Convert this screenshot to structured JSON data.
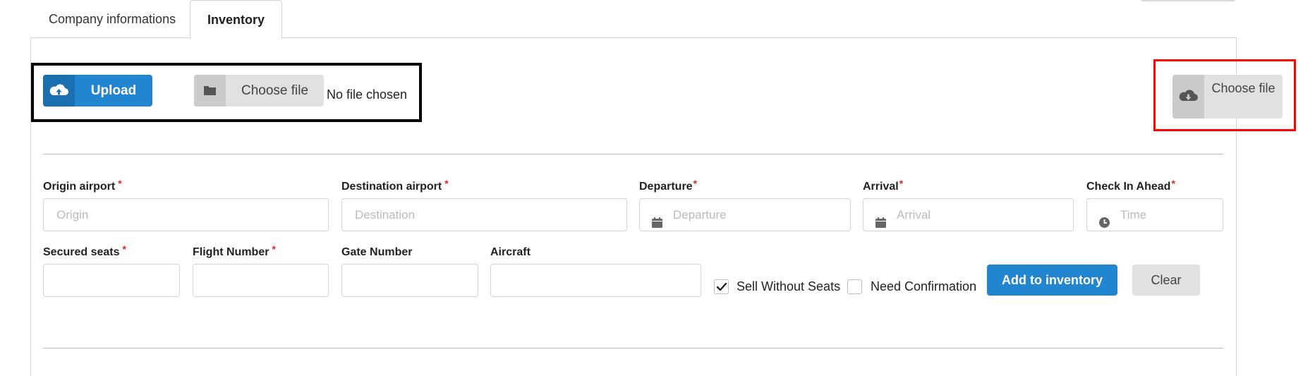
{
  "tabs": [
    {
      "label": "Company informations",
      "active": false
    },
    {
      "label": "Inventory",
      "active": true
    }
  ],
  "upload": {
    "upload_button_label": "Upload",
    "choose_file_label": "Choose file",
    "no_file_text": "No file chosen",
    "download_choose_file_label": "Choose file"
  },
  "form": {
    "origin_airport": {
      "label": "Origin airport",
      "placeholder": "Origin",
      "required": "*"
    },
    "destination_airport": {
      "label": "Destination airport",
      "placeholder": "Destination",
      "required": "*"
    },
    "departure": {
      "label": "Departure",
      "placeholder": "Departure",
      "required": "*"
    },
    "arrival": {
      "label": "Arrival",
      "placeholder": "Arrival",
      "required": "*"
    },
    "check_in_ahead": {
      "label": "Check In Ahead",
      "placeholder": "Time",
      "required": "*"
    },
    "secured_seats": {
      "label": "Secured seats",
      "value": "",
      "required": "*"
    },
    "flight_number": {
      "label": "Flight Number",
      "value": "",
      "required": "*"
    },
    "gate_number": {
      "label": "Gate Number",
      "value": ""
    },
    "aircraft": {
      "label": "Aircraft",
      "value": ""
    },
    "sell_without_seats": {
      "label": "Sell Without Seats",
      "checked": true
    },
    "need_confirmation": {
      "label": "Need Confirmation",
      "checked": false
    },
    "add_button_label": "Add to inventory",
    "clear_button_label": "Clear"
  },
  "colors": {
    "primary": "#2185d0",
    "secondary_button": "#e0e1e2",
    "required": "#db2828",
    "highlight_red": "#ff0000",
    "highlight_black": "#000000"
  },
  "icons": {
    "upload": "cloud-upload-icon",
    "choose_file": "folder-icon",
    "download": "cloud-download-icon",
    "departure": "calendar-icon",
    "arrival": "calendar-icon",
    "check_in_ahead": "clock-icon",
    "checkbox": "check-icon"
  }
}
